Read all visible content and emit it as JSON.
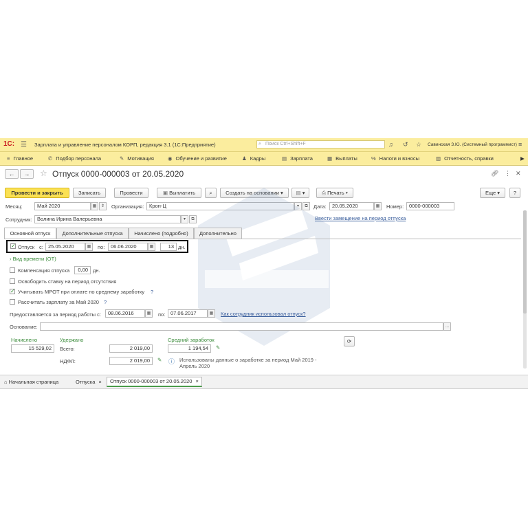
{
  "titlebar": {
    "logo": "1С:",
    "app_title": "Зарплата и управление персоналом КОРП, редакция 3.1  (1С:Предприятие)",
    "search_placeholder": "Поиск Ctrl+Shift+F",
    "user": "Савинская З.Ю. (Системный программист)"
  },
  "sections": [
    "Главное",
    "Подбор персонала",
    "Мотивация",
    "Обучение и развитие",
    "Кадры",
    "Зарплата",
    "Выплаты",
    "Налоги и взносы",
    "Отчетность, справки"
  ],
  "form": {
    "title": "Отпуск 0000-000003 от 20.05.2020",
    "toolbar": {
      "post_close": "Провести и закрыть",
      "save": "Записать",
      "post": "Провести",
      "pay": "Выплатить",
      "create_based": "Создать на основании",
      "print": "Печать",
      "more": "Еще"
    },
    "header": {
      "month_label": "Месяц:",
      "month_value": "Май 2020",
      "org_label": "Организация:",
      "org_value": "Крон-Ц",
      "date_label": "Дата:",
      "date_value": "20.05.2020",
      "number_label": "Номер:",
      "number_value": "0000-000003",
      "employee_label": "Сотрудник:",
      "employee_value": "Волина Ирина Валерьевна",
      "replacement_link": "Ввести замещение на период отпуска"
    },
    "tabs": [
      "Основной отпуск",
      "Дополнительные отпуска",
      "Начислено (подробно)",
      "Дополнительно"
    ],
    "vacation": {
      "checkbox_label": "Отпуск",
      "from_label": "с:",
      "from_value": "25.05.2020",
      "to_label": "по:",
      "to_value": "06.06.2020",
      "days_value": "13",
      "days_unit": "дн.",
      "time_type_link": "Вид времени (ОТ)",
      "compensation_label": "Компенсация отпуска",
      "compensation_value": "0,00",
      "compensation_unit": "дн.",
      "release_rate_label": "Освободить ставку на период отсутствия",
      "mrot_label": "Учитывать МРОТ при оплате по среднему заработку",
      "help": "?",
      "calc_salary_label": "Рассчитать зарплату за Май 2020",
      "calc_salary_help": "?",
      "period_label": "Предоставляется за период работы с:",
      "period_from": "08.06.2016",
      "period_to_label": "по:",
      "period_to": "07.06.2017",
      "usage_link": "Как сотрудник использовал отпуск?",
      "basis_label": "Основание:",
      "basis_value": "",
      "basis_btn": "..."
    },
    "totals": {
      "accrued_label": "Начислено",
      "accrued_value": "15 529,02",
      "withheld_label": "Удержано",
      "total_label": "Всего:",
      "total_value": "2 019,00",
      "ndfl_label": "НДФЛ:",
      "ndfl_value": "2 019,00",
      "avg_label": "Средний заработок",
      "avg_value": "1 194,54",
      "info_text": "Использованы данные о заработке за период Май 2019 - Апрель 2020"
    }
  },
  "taskbar": {
    "home": "Начальная страница",
    "tab1": "Отпуска",
    "tab2": "Отпуск 0000-000003 от 20.05.2020",
    "close": "×"
  },
  "colors": {
    "accent": "#fbe153",
    "titlebar": "#fbed9e",
    "link": "#3a5e9c",
    "green": "#3c8c3c",
    "logo_red": "#c8161d"
  }
}
